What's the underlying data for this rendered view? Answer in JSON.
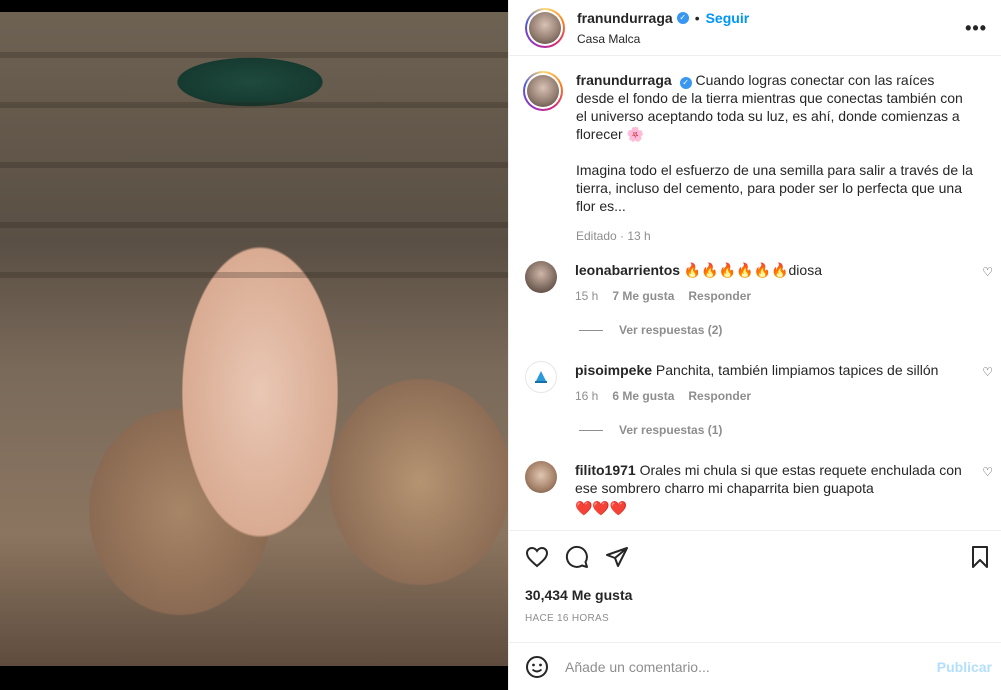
{
  "post": {
    "username": "franundurraga",
    "follow_label": "Seguir",
    "dot": "•",
    "location": "Casa Malca",
    "more": "•••"
  },
  "caption": {
    "username": "franundurraga",
    "paragraph1": "Cuando logras conectar con las raíces desde el fondo de la tierra mientras que conectas también con el universo aceptando toda su luz, es ahí, donde comienzas a florecer 🌸",
    "paragraph2": "Imagina todo el esfuerzo de una semilla para salir a través de la tierra, incluso del cemento, para poder ser lo perfecta que una flor es...",
    "meta": "Editado · 13 h"
  },
  "comments": [
    {
      "username": "leonabarrientos",
      "text": "🔥🔥🔥🔥🔥🔥diosa",
      "time": "15 h",
      "likes": "7 Me gusta",
      "reply": "Responder",
      "view_replies": "Ver respuestas (2)"
    },
    {
      "username": "pisoimpeke",
      "text": "Panchita, también limpiamos tapices de sillón",
      "time": "16 h",
      "likes": "6 Me gusta",
      "reply": "Responder",
      "view_replies": "Ver respuestas (1)"
    },
    {
      "username": "filito1971",
      "text": "Orales mi chula si que estas requete enchulada con ese sombrero charro mi chaparrita bien guapota",
      "text2": "❤️❤️❤️"
    }
  ],
  "actions": {
    "likes": "30,434 Me gusta",
    "posted": "HACE 16 HORAS"
  },
  "add_comment": {
    "placeholder": "Añade un comentario...",
    "publish": "Publicar"
  },
  "colors": {
    "accent": "#0095f6",
    "publish_disabled": "#b2dffc",
    "verified": "#3897f0"
  },
  "icons": [
    "more-icon",
    "verified-icon",
    "heart-icon",
    "comment-icon",
    "share-icon",
    "bookmark-icon",
    "emoji-icon"
  ]
}
